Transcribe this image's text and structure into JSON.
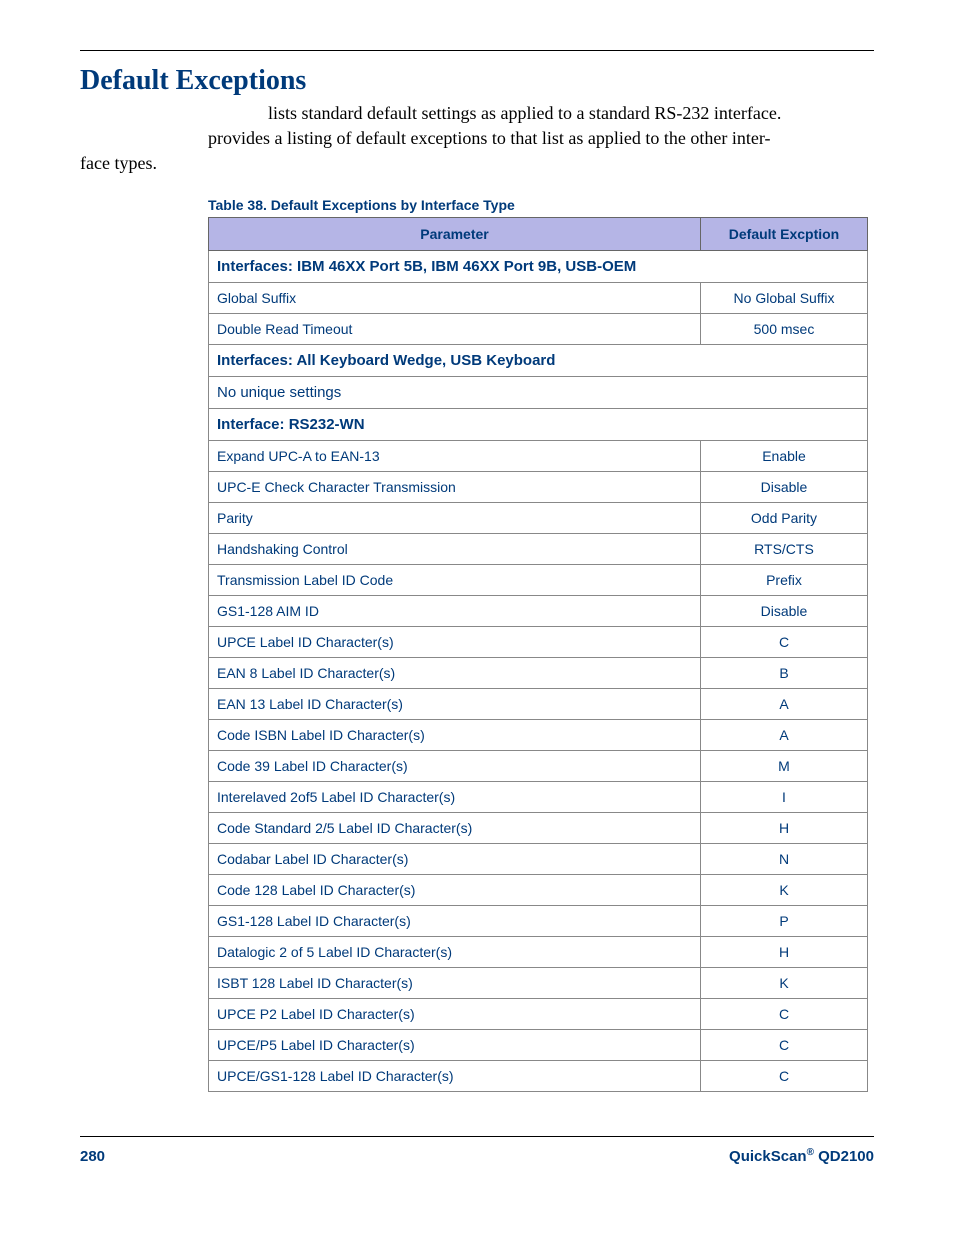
{
  "heading": "Default Exceptions",
  "intro_line1": "lists standard default settings as applied to a standard RS-232 interface.",
  "intro_line2": "provides a listing of default exceptions to that list as applied to the other inter-",
  "intro_line3": "face types.",
  "table_caption": "Table 38. Default Exceptions by Interface Type",
  "columns": {
    "param": "Parameter",
    "value": "Default Excption"
  },
  "rows": [
    {
      "type": "section",
      "text": "Interfaces: IBM 46XX Port 5B, IBM 46XX Port 9B, USB-OEM"
    },
    {
      "type": "data",
      "param": "Global Suffix",
      "value": "No Global Suffix"
    },
    {
      "type": "data",
      "param": "Double Read Timeout",
      "value": "500 msec"
    },
    {
      "type": "section",
      "text": "Interfaces: All Keyboard Wedge, USB Keyboard"
    },
    {
      "type": "plain",
      "text": "No unique settings"
    },
    {
      "type": "section",
      "text": "Interface: RS232-WN"
    },
    {
      "type": "data",
      "param": "Expand UPC-A to EAN-13",
      "value": "Enable"
    },
    {
      "type": "data",
      "param": "UPC-E Check Character Transmission",
      "value": "Disable"
    },
    {
      "type": "data",
      "param": "Parity",
      "value": "Odd Parity"
    },
    {
      "type": "data",
      "param": "Handshaking Control",
      "value": "RTS/CTS"
    },
    {
      "type": "data",
      "param": "Transmission Label ID Code",
      "value": "Prefix"
    },
    {
      "type": "data",
      "param": "GS1-128 AIM ID",
      "value": "Disable"
    },
    {
      "type": "data",
      "param": "UPCE Label ID Character(s)",
      "value": "C"
    },
    {
      "type": "data",
      "param": "EAN 8 Label ID Character(s)",
      "value": "B"
    },
    {
      "type": "data",
      "param": "EAN 13 Label ID Character(s)",
      "value": "A"
    },
    {
      "type": "data",
      "param": "Code ISBN Label ID Character(s)",
      "value": "A"
    },
    {
      "type": "data",
      "param": "Code 39 Label ID Character(s)",
      "value": "M"
    },
    {
      "type": "data",
      "param": "Interelaved 2of5 Label ID Character(s)",
      "value": "I"
    },
    {
      "type": "data",
      "param": "Code Standard 2/5 Label ID Character(s)",
      "value": "H"
    },
    {
      "type": "data",
      "param": "Codabar Label ID Character(s)",
      "value": "N"
    },
    {
      "type": "data",
      "param": "Code 128 Label ID Character(s)",
      "value": "K"
    },
    {
      "type": "data",
      "param": "GS1-128 Label ID Character(s)",
      "value": "P"
    },
    {
      "type": "data",
      "param": "Datalogic 2 of 5 Label ID Character(s)",
      "value": "H"
    },
    {
      "type": "data",
      "param": "ISBT 128 Label ID Character(s)",
      "value": "K"
    },
    {
      "type": "data",
      "param": "UPCE P2 Label ID Character(s)",
      "value": "C"
    },
    {
      "type": "data",
      "param": "UPCE/P5 Label ID Character(s)",
      "value": "C"
    },
    {
      "type": "data",
      "param": "UPCE/GS1-128 Label ID Character(s)",
      "value": "C"
    }
  ],
  "footer": {
    "page": "280",
    "product_prefix": "QuickScan",
    "product_reg": "®",
    "product_suffix": " QD2100"
  }
}
